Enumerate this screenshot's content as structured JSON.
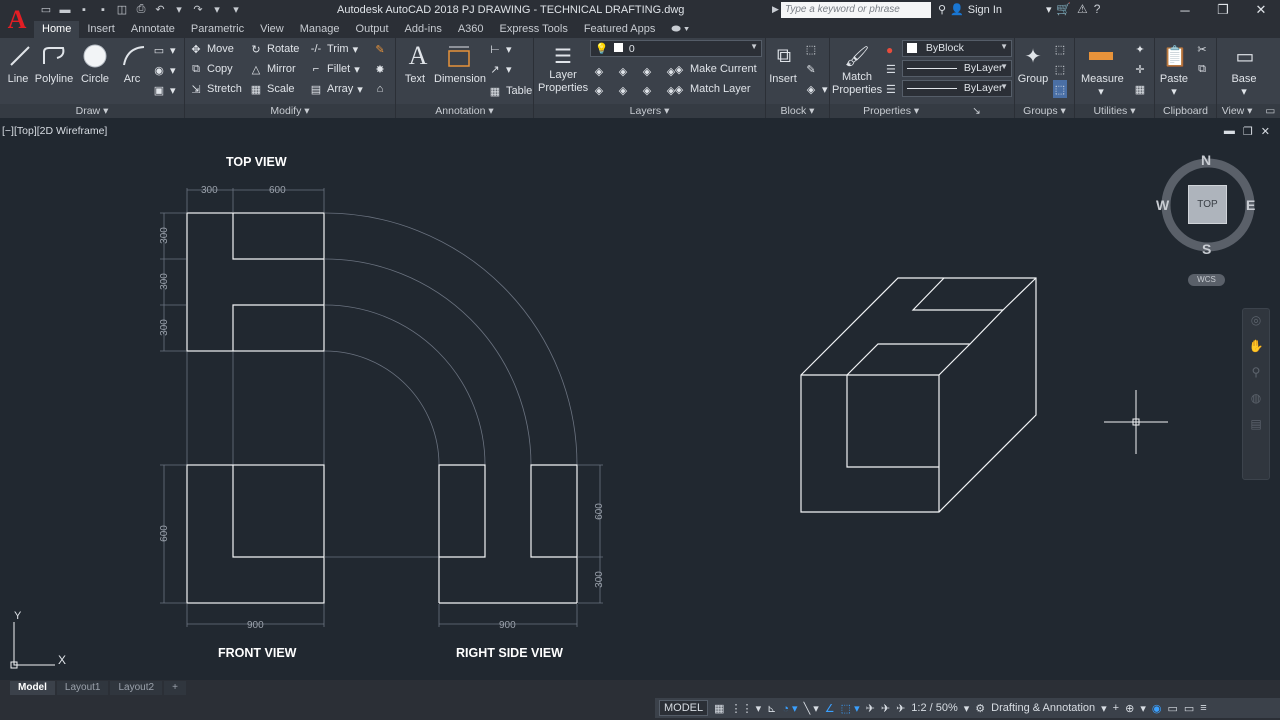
{
  "app": {
    "title": "Autodesk AutoCAD 2018    PJ DRAWING - TECHNICAL DRAFTING.dwg",
    "logo": "A",
    "search_placeholder": "Type a keyword or phrase",
    "sign_in": "Sign In"
  },
  "tabs": [
    "Home",
    "Insert",
    "Annotate",
    "Parametric",
    "View",
    "Manage",
    "Output",
    "Add-ins",
    "A360",
    "Express Tools",
    "Featured Apps"
  ],
  "ribbon": {
    "draw": {
      "title": "Draw",
      "line": "Line",
      "polyline": "Polyline",
      "circle": "Circle",
      "arc": "Arc"
    },
    "modify": {
      "title": "Modify",
      "move": "Move",
      "rotate": "Rotate",
      "trim": "Trim",
      "copy": "Copy",
      "mirror": "Mirror",
      "fillet": "Fillet",
      "stretch": "Stretch",
      "scale": "Scale",
      "array": "Array"
    },
    "annotation": {
      "title": "Annotation",
      "text": "Text",
      "dimension": "Dimension",
      "table": "Table"
    },
    "layers": {
      "title": "Layers",
      "layer_properties": "Layer Properties",
      "current_layer": "0",
      "make_current": "Make Current",
      "match_layer": "Match Layer"
    },
    "block": {
      "title": "Block",
      "insert": "Insert"
    },
    "properties": {
      "title": "Properties",
      "match_properties": "Match Properties",
      "color": "ByBlock",
      "linetype": "ByLayer",
      "lineweight": "ByLayer"
    },
    "groups": {
      "title": "Groups",
      "group": "Group"
    },
    "utilities": {
      "title": "Utilities",
      "measure": "Measure"
    },
    "clipboard": {
      "title": "Clipboard",
      "paste": "Paste"
    },
    "view": {
      "title": "View",
      "base": "Base"
    }
  },
  "viewport": {
    "label": "[−][Top][2D Wireframe]",
    "top_view": "TOP VIEW",
    "front_view": "FRONT VIEW",
    "right_side_view": "RIGHT SIDE VIEW",
    "dims": {
      "top_300": "300",
      "top_600": "600",
      "left_300a": "300",
      "left_300b": "300",
      "left_300c": "300",
      "front_600": "600",
      "front_900": "900",
      "right_600": "600",
      "right_300": "300",
      "right_900": "900"
    },
    "ucs_x": "X",
    "ucs_y": "Y"
  },
  "viewcube": {
    "n": "N",
    "s": "S",
    "e": "E",
    "w": "W",
    "face": "TOP",
    "wcs": "WCS"
  },
  "layout_tabs": [
    "Model",
    "Layout1",
    "Layout2"
  ],
  "status": {
    "model": "MODEL",
    "scale": "1:2 / 50%",
    "workspace": "Drafting & Annotation"
  }
}
